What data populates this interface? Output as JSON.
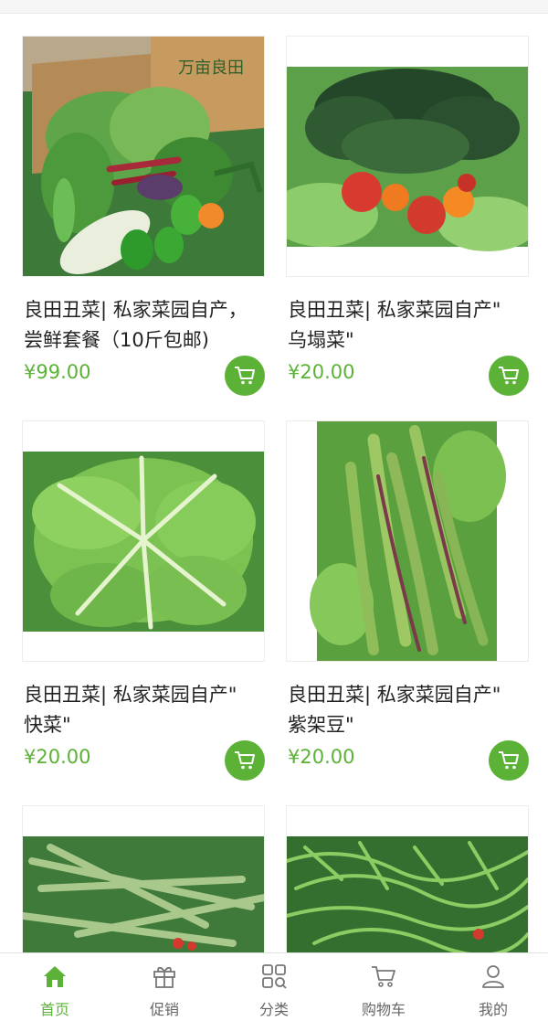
{
  "products": [
    {
      "title": "良田丑菜| 私家菜园自产，\n尝鲜套餐（10斤包邮)",
      "price": "¥99.00",
      "image": "vegetable-box-photo",
      "box_text": "万亩良田"
    },
    {
      "title": "良田丑菜| 私家菜园自产\"\n乌塌菜\"",
      "price": "¥20.00",
      "image": "wutacai-with-tomatoes-photo"
    },
    {
      "title": "良田丑菜| 私家菜园自产\"\n快菜\"",
      "price": "¥20.00",
      "image": "kuaicai-photo"
    },
    {
      "title": "良田丑菜| 私家菜园自产\"\n紫架豆\"",
      "price": "¥20.00",
      "image": "purple-beans-photo"
    },
    {
      "title": "",
      "price": "",
      "image": "long-leaf-greens-photo"
    },
    {
      "title": "",
      "price": "",
      "image": "frisee-greens-photo"
    }
  ],
  "tabbar": [
    {
      "label": "首页",
      "icon": "home-icon",
      "active": true
    },
    {
      "label": "促销",
      "icon": "gift-icon",
      "active": false
    },
    {
      "label": "分类",
      "icon": "category-grid-icon",
      "active": false
    },
    {
      "label": "购物车",
      "icon": "cart-icon",
      "active": false
    },
    {
      "label": "我的",
      "icon": "user-icon",
      "active": false
    }
  ],
  "colors": {
    "accent": "#5bb236",
    "text": "#222222",
    "tab_inactive": "#666666"
  }
}
